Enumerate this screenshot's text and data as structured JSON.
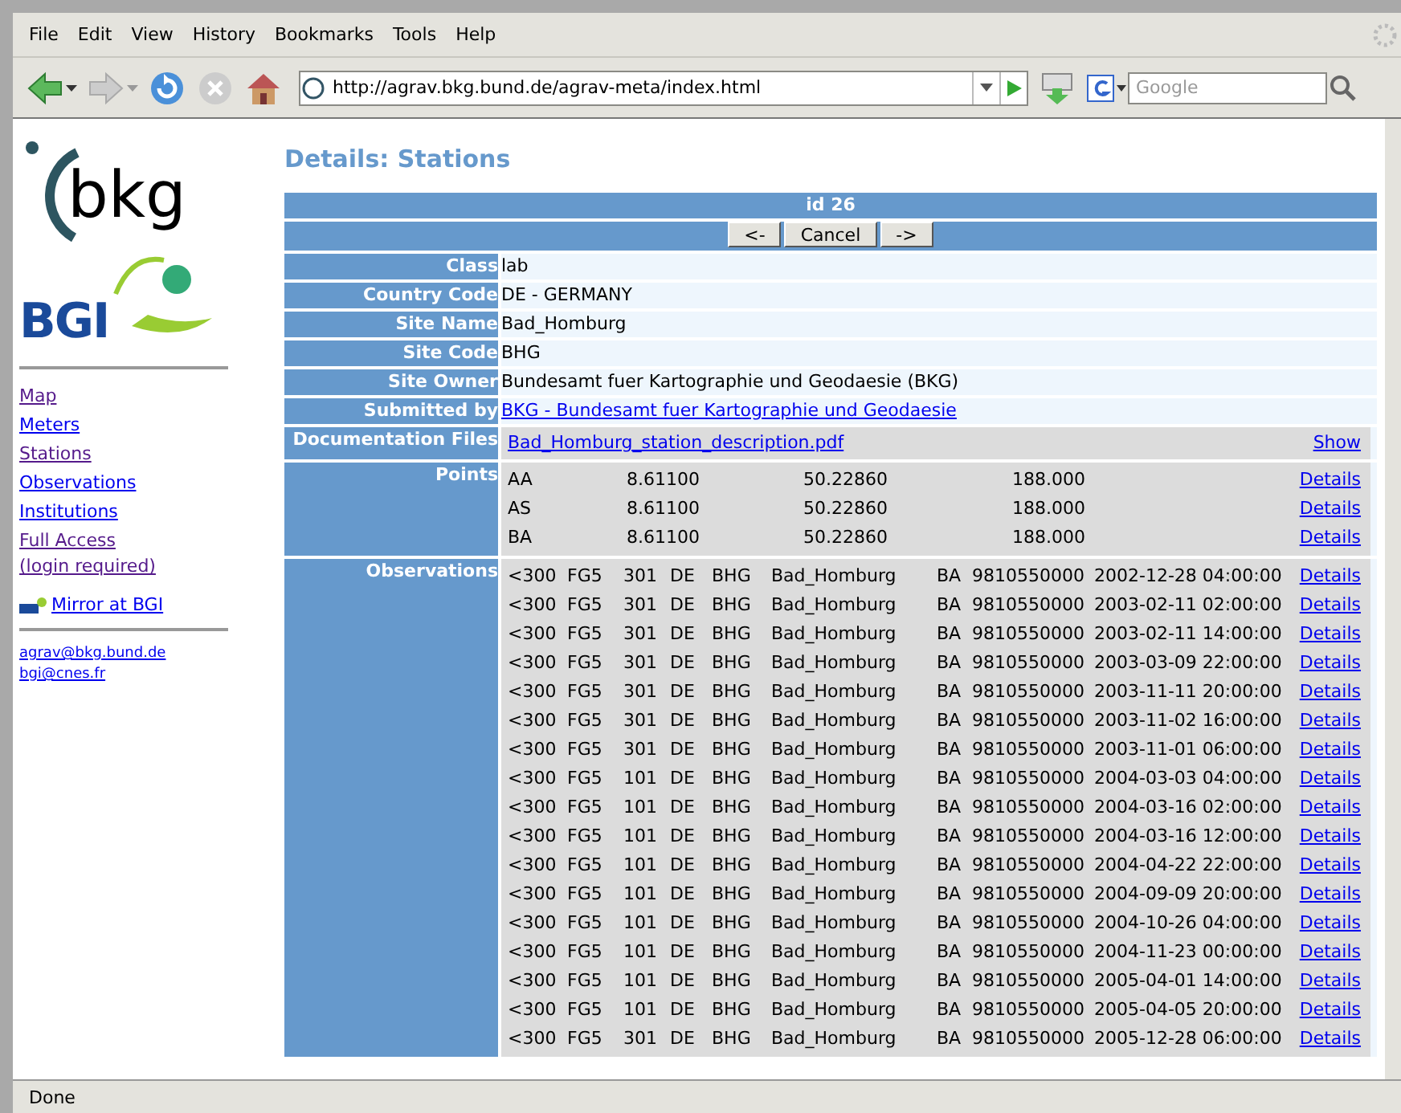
{
  "menu": [
    "File",
    "Edit",
    "View",
    "History",
    "Bookmarks",
    "Tools",
    "Help"
  ],
  "toolbar": {
    "url": "http://agrav.bkg.bund.de/agrav-meta/index.html",
    "search_placeholder": "Google"
  },
  "sidebar": {
    "logo_text": "bkg",
    "logo2_text": "BGI",
    "nav": [
      {
        "label": "Map",
        "visited": true
      },
      {
        "label": "Meters",
        "visited": false
      },
      {
        "label": "Stations",
        "visited": true
      },
      {
        "label": "Observations",
        "visited": false
      },
      {
        "label": "Institutions",
        "visited": false
      },
      {
        "label": "Full Access",
        "visited": true
      },
      {
        "label": "(login required)",
        "visited": true
      }
    ],
    "mirror": "Mirror at BGI",
    "emails": [
      "agrav@bkg.bund.de",
      "bgi@cnes.fr"
    ]
  },
  "page_title": "Details: Stations",
  "record": {
    "header": "id 26",
    "buttons": [
      "<-",
      "Cancel",
      "->"
    ],
    "fields": [
      {
        "label": "Class",
        "value": "lab",
        "kind": "text"
      },
      {
        "label": "Country Code",
        "value": "DE - GERMANY",
        "kind": "text"
      },
      {
        "label": "Site Name",
        "value": "Bad_Homburg",
        "kind": "text"
      },
      {
        "label": "Site Code",
        "value": "BHG",
        "kind": "text"
      },
      {
        "label": "Site Owner",
        "value": "Bundesamt fuer Kartographie und Geodaesie (BKG)",
        "kind": "text"
      },
      {
        "label": "Submitted by",
        "value": "BKG - Bundesamt fuer Kartographie und Geodaesie",
        "kind": "link"
      }
    ],
    "documentation": {
      "label": "Documentation Files",
      "file": "Bad_Homburg_station_description.pdf",
      "action": "Show"
    },
    "points": {
      "label": "Points",
      "rows": [
        {
          "cells": [
            "AA",
            "8.61100",
            "50.22860",
            "188.000"
          ],
          "action": "Details"
        },
        {
          "cells": [
            "AS",
            "8.61100",
            "50.22860",
            "188.000"
          ],
          "action": "Details"
        },
        {
          "cells": [
            "BA",
            "8.61100",
            "50.22860",
            "188.000"
          ],
          "action": "Details"
        }
      ]
    },
    "observations": {
      "label": "Observations",
      "rows": [
        {
          "cells": [
            "<300",
            "FG5",
            "301",
            "DE",
            "BHG",
            "Bad_Homburg",
            "BA",
            "9810550000",
            "2002-12-28 04:00:00"
          ],
          "action": "Details"
        },
        {
          "cells": [
            "<300",
            "FG5",
            "301",
            "DE",
            "BHG",
            "Bad_Homburg",
            "BA",
            "9810550000",
            "2003-02-11 02:00:00"
          ],
          "action": "Details"
        },
        {
          "cells": [
            "<300",
            "FG5",
            "301",
            "DE",
            "BHG",
            "Bad_Homburg",
            "BA",
            "9810550000",
            "2003-02-11 14:00:00"
          ],
          "action": "Details"
        },
        {
          "cells": [
            "<300",
            "FG5",
            "301",
            "DE",
            "BHG",
            "Bad_Homburg",
            "BA",
            "9810550000",
            "2003-03-09 22:00:00"
          ],
          "action": "Details"
        },
        {
          "cells": [
            "<300",
            "FG5",
            "301",
            "DE",
            "BHG",
            "Bad_Homburg",
            "BA",
            "9810550000",
            "2003-11-11 20:00:00"
          ],
          "action": "Details"
        },
        {
          "cells": [
            "<300",
            "FG5",
            "301",
            "DE",
            "BHG",
            "Bad_Homburg",
            "BA",
            "9810550000",
            "2003-11-02 16:00:00"
          ],
          "action": "Details"
        },
        {
          "cells": [
            "<300",
            "FG5",
            "301",
            "DE",
            "BHG",
            "Bad_Homburg",
            "BA",
            "9810550000",
            "2003-11-01 06:00:00"
          ],
          "action": "Details"
        },
        {
          "cells": [
            "<300",
            "FG5",
            "101",
            "DE",
            "BHG",
            "Bad_Homburg",
            "BA",
            "9810550000",
            "2004-03-03 04:00:00"
          ],
          "action": "Details"
        },
        {
          "cells": [
            "<300",
            "FG5",
            "101",
            "DE",
            "BHG",
            "Bad_Homburg",
            "BA",
            "9810550000",
            "2004-03-16 02:00:00"
          ],
          "action": "Details"
        },
        {
          "cells": [
            "<300",
            "FG5",
            "101",
            "DE",
            "BHG",
            "Bad_Homburg",
            "BA",
            "9810550000",
            "2004-03-16 12:00:00"
          ],
          "action": "Details"
        },
        {
          "cells": [
            "<300",
            "FG5",
            "101",
            "DE",
            "BHG",
            "Bad_Homburg",
            "BA",
            "9810550000",
            "2004-04-22 22:00:00"
          ],
          "action": "Details"
        },
        {
          "cells": [
            "<300",
            "FG5",
            "101",
            "DE",
            "BHG",
            "Bad_Homburg",
            "BA",
            "9810550000",
            "2004-09-09 20:00:00"
          ],
          "action": "Details"
        },
        {
          "cells": [
            "<300",
            "FG5",
            "101",
            "DE",
            "BHG",
            "Bad_Homburg",
            "BA",
            "9810550000",
            "2004-10-26 04:00:00"
          ],
          "action": "Details"
        },
        {
          "cells": [
            "<300",
            "FG5",
            "101",
            "DE",
            "BHG",
            "Bad_Homburg",
            "BA",
            "9810550000",
            "2004-11-23 00:00:00"
          ],
          "action": "Details"
        },
        {
          "cells": [
            "<300",
            "FG5",
            "101",
            "DE",
            "BHG",
            "Bad_Homburg",
            "BA",
            "9810550000",
            "2005-04-01 14:00:00"
          ],
          "action": "Details"
        },
        {
          "cells": [
            "<300",
            "FG5",
            "101",
            "DE",
            "BHG",
            "Bad_Homburg",
            "BA",
            "9810550000",
            "2005-04-05 20:00:00"
          ],
          "action": "Details"
        },
        {
          "cells": [
            "<300",
            "FG5",
            "301",
            "DE",
            "BHG",
            "Bad_Homburg",
            "BA",
            "9810550000",
            "2005-12-28 06:00:00"
          ],
          "action": "Details"
        }
      ]
    }
  },
  "status_bar": "Done"
}
